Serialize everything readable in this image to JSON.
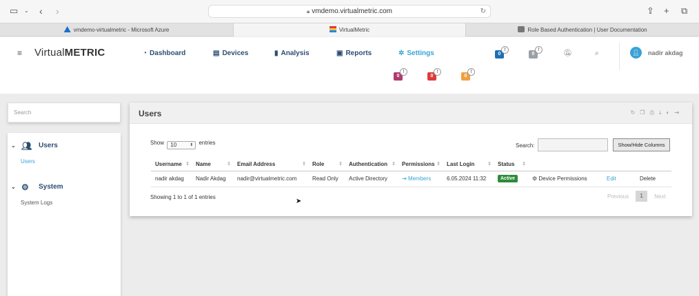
{
  "browser": {
    "url": "vmdemo.virtualmetric.com",
    "tabs": [
      {
        "label": "vmdemo-virtualmetric - Microsoft Azure"
      },
      {
        "label": "VirtualMetric"
      },
      {
        "label": "Role Based Authentication | User Documentation"
      }
    ]
  },
  "app": {
    "logo_part1": "Virtual",
    "logo_part2": "METRIC",
    "nav": [
      {
        "label": "Dashboard"
      },
      {
        "label": "Devices"
      },
      {
        "label": "Analysis"
      },
      {
        "label": "Reports"
      },
      {
        "label": "Settings"
      }
    ],
    "badges": [
      {
        "count": "0",
        "color": "#1f6fb2"
      },
      {
        "count": "0",
        "color": "#9aa0a6"
      },
      {
        "count": "0",
        "color": "#b03a6e"
      },
      {
        "count": "0",
        "color": "#e03a3a"
      },
      {
        "count": "0",
        "color": "#f0a040"
      }
    ],
    "badge_dot": "!",
    "user": "nadir akdag"
  },
  "sidebar": {
    "search_placeholder": "Search",
    "groups": [
      {
        "label": "Users",
        "items": [
          {
            "label": "Users"
          }
        ]
      },
      {
        "label": "System",
        "items": [
          {
            "label": "System Logs"
          }
        ]
      }
    ]
  },
  "panel": {
    "title": "Users",
    "show_label": "Show",
    "entries_value": "10",
    "entries_label": "entries",
    "search_label": "Search:",
    "columns_button": "Show/Hide Columns",
    "columns": [
      "Username",
      "Name",
      "Email Address",
      "Role",
      "Authentication",
      "Permissions",
      "Last Login",
      "Status"
    ],
    "rows": [
      {
        "username": "nadir akdag",
        "name": "Nadir Akdag",
        "email": "nadir@virtualmetric.com",
        "role": "Read Only",
        "authentication": "Active Directory",
        "permissions": "Members",
        "last_login": "6.05.2024 11:32",
        "status": "Active",
        "device_permissions": "Device Permissions",
        "edit": "Edit",
        "delete": "Delete"
      }
    ],
    "info": "Showing 1 to 1 of 1 entries",
    "pager": {
      "previous": "Previous",
      "page": "1",
      "next": "Next"
    }
  },
  "colors": {
    "accent": "#3aa2d6",
    "nav": "#2b4d72",
    "active_status": "#2e8b3a"
  }
}
